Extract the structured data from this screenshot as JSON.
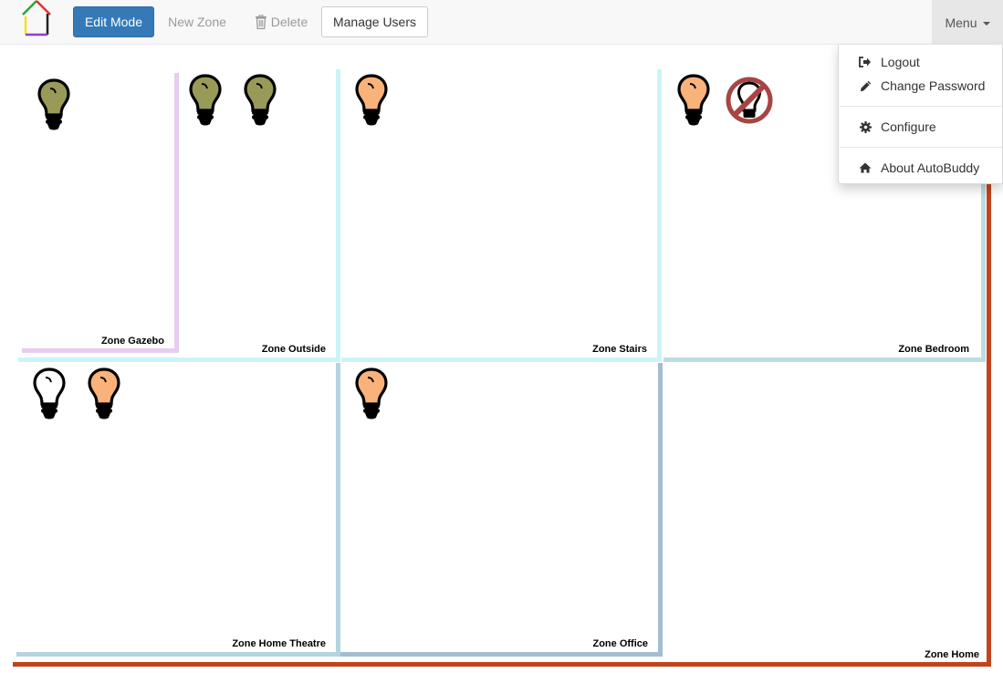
{
  "navbar": {
    "logo_icon": "house-logo-icon",
    "edit_mode_label": "Edit Mode",
    "new_zone_label": "New Zone",
    "delete_label": "Delete",
    "delete_icon": "trash-icon",
    "manage_users_label": "Manage Users",
    "menu_label": "Menu"
  },
  "menu": {
    "items": [
      {
        "label": "Logout",
        "icon": "logout-icon"
      },
      {
        "label": "Change Password",
        "icon": "pencil-icon"
      },
      {
        "label": "Configure",
        "icon": "gear-icon"
      },
      {
        "label": "About AutoBuddy",
        "icon": "home-icon"
      }
    ]
  },
  "colors": {
    "primary_button": "#337ab7",
    "bulb_on": "#f9b27a",
    "bulb_dim": "#9a9a58",
    "bulb_off": "#ffffff",
    "blocked": "#a84444",
    "zone_home": "#c0441c",
    "zone_gazebo": "#e8ccf0",
    "zone_outside": "#ccf4f8",
    "zone_stairs": "#ccf4f8",
    "zone_bedroom": "#bcdce6",
    "zone_home_theatre": "#b4d4e0",
    "zone_office": "#a4bcd4"
  },
  "zones": {
    "gazebo": {
      "name": "Zone Gazebo",
      "devices": [
        "bulb-dim"
      ]
    },
    "outside": {
      "name": "Zone Outside",
      "devices": [
        "bulb-dim",
        "bulb-dim"
      ]
    },
    "stairs": {
      "name": "Zone Stairs",
      "devices": [
        "bulb-on"
      ]
    },
    "bedroom": {
      "name": "Zone Bedroom",
      "devices": [
        "bulb-on",
        "bulb-blocked"
      ]
    },
    "home_theatre": {
      "name": "Zone Home Theatre",
      "devices": [
        "bulb-off",
        "bulb-on"
      ]
    },
    "office": {
      "name": "Zone Office",
      "devices": [
        "bulb-on"
      ]
    },
    "home": {
      "name": "Zone Home",
      "devices": []
    }
  }
}
